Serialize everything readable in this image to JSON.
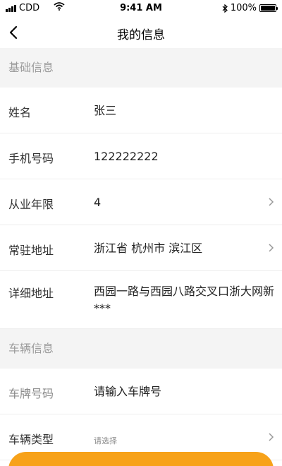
{
  "status": {
    "carrier": "CDD",
    "time": "9:41 AM",
    "battery": "100%"
  },
  "nav": {
    "title": "我的信息"
  },
  "sections": {
    "basic": "基础信息",
    "vehicle": "车辆信息"
  },
  "basic": {
    "name": {
      "label": "姓名",
      "value": "张三"
    },
    "phone": {
      "label": "手机号码",
      "value": "122222222"
    },
    "years": {
      "label": "从业年限",
      "value": "4"
    },
    "address": {
      "label": "常驻地址",
      "value": "浙江省 杭州市 滨江区"
    },
    "detail": {
      "label": "详细地址",
      "value": "西园一路与西园八路交叉口浙大网新***"
    }
  },
  "vehicle": {
    "plate": {
      "label": "车牌号码",
      "placeholder": "请输入车牌号"
    },
    "type": {
      "label": "车辆类型",
      "placeholder": "请选择"
    }
  },
  "colors": {
    "accent": "#f7a21a",
    "section_bg": "#f4f4f4"
  },
  "icons": {
    "back": "chevron-left-icon",
    "arrow": "chevron-right-icon"
  }
}
